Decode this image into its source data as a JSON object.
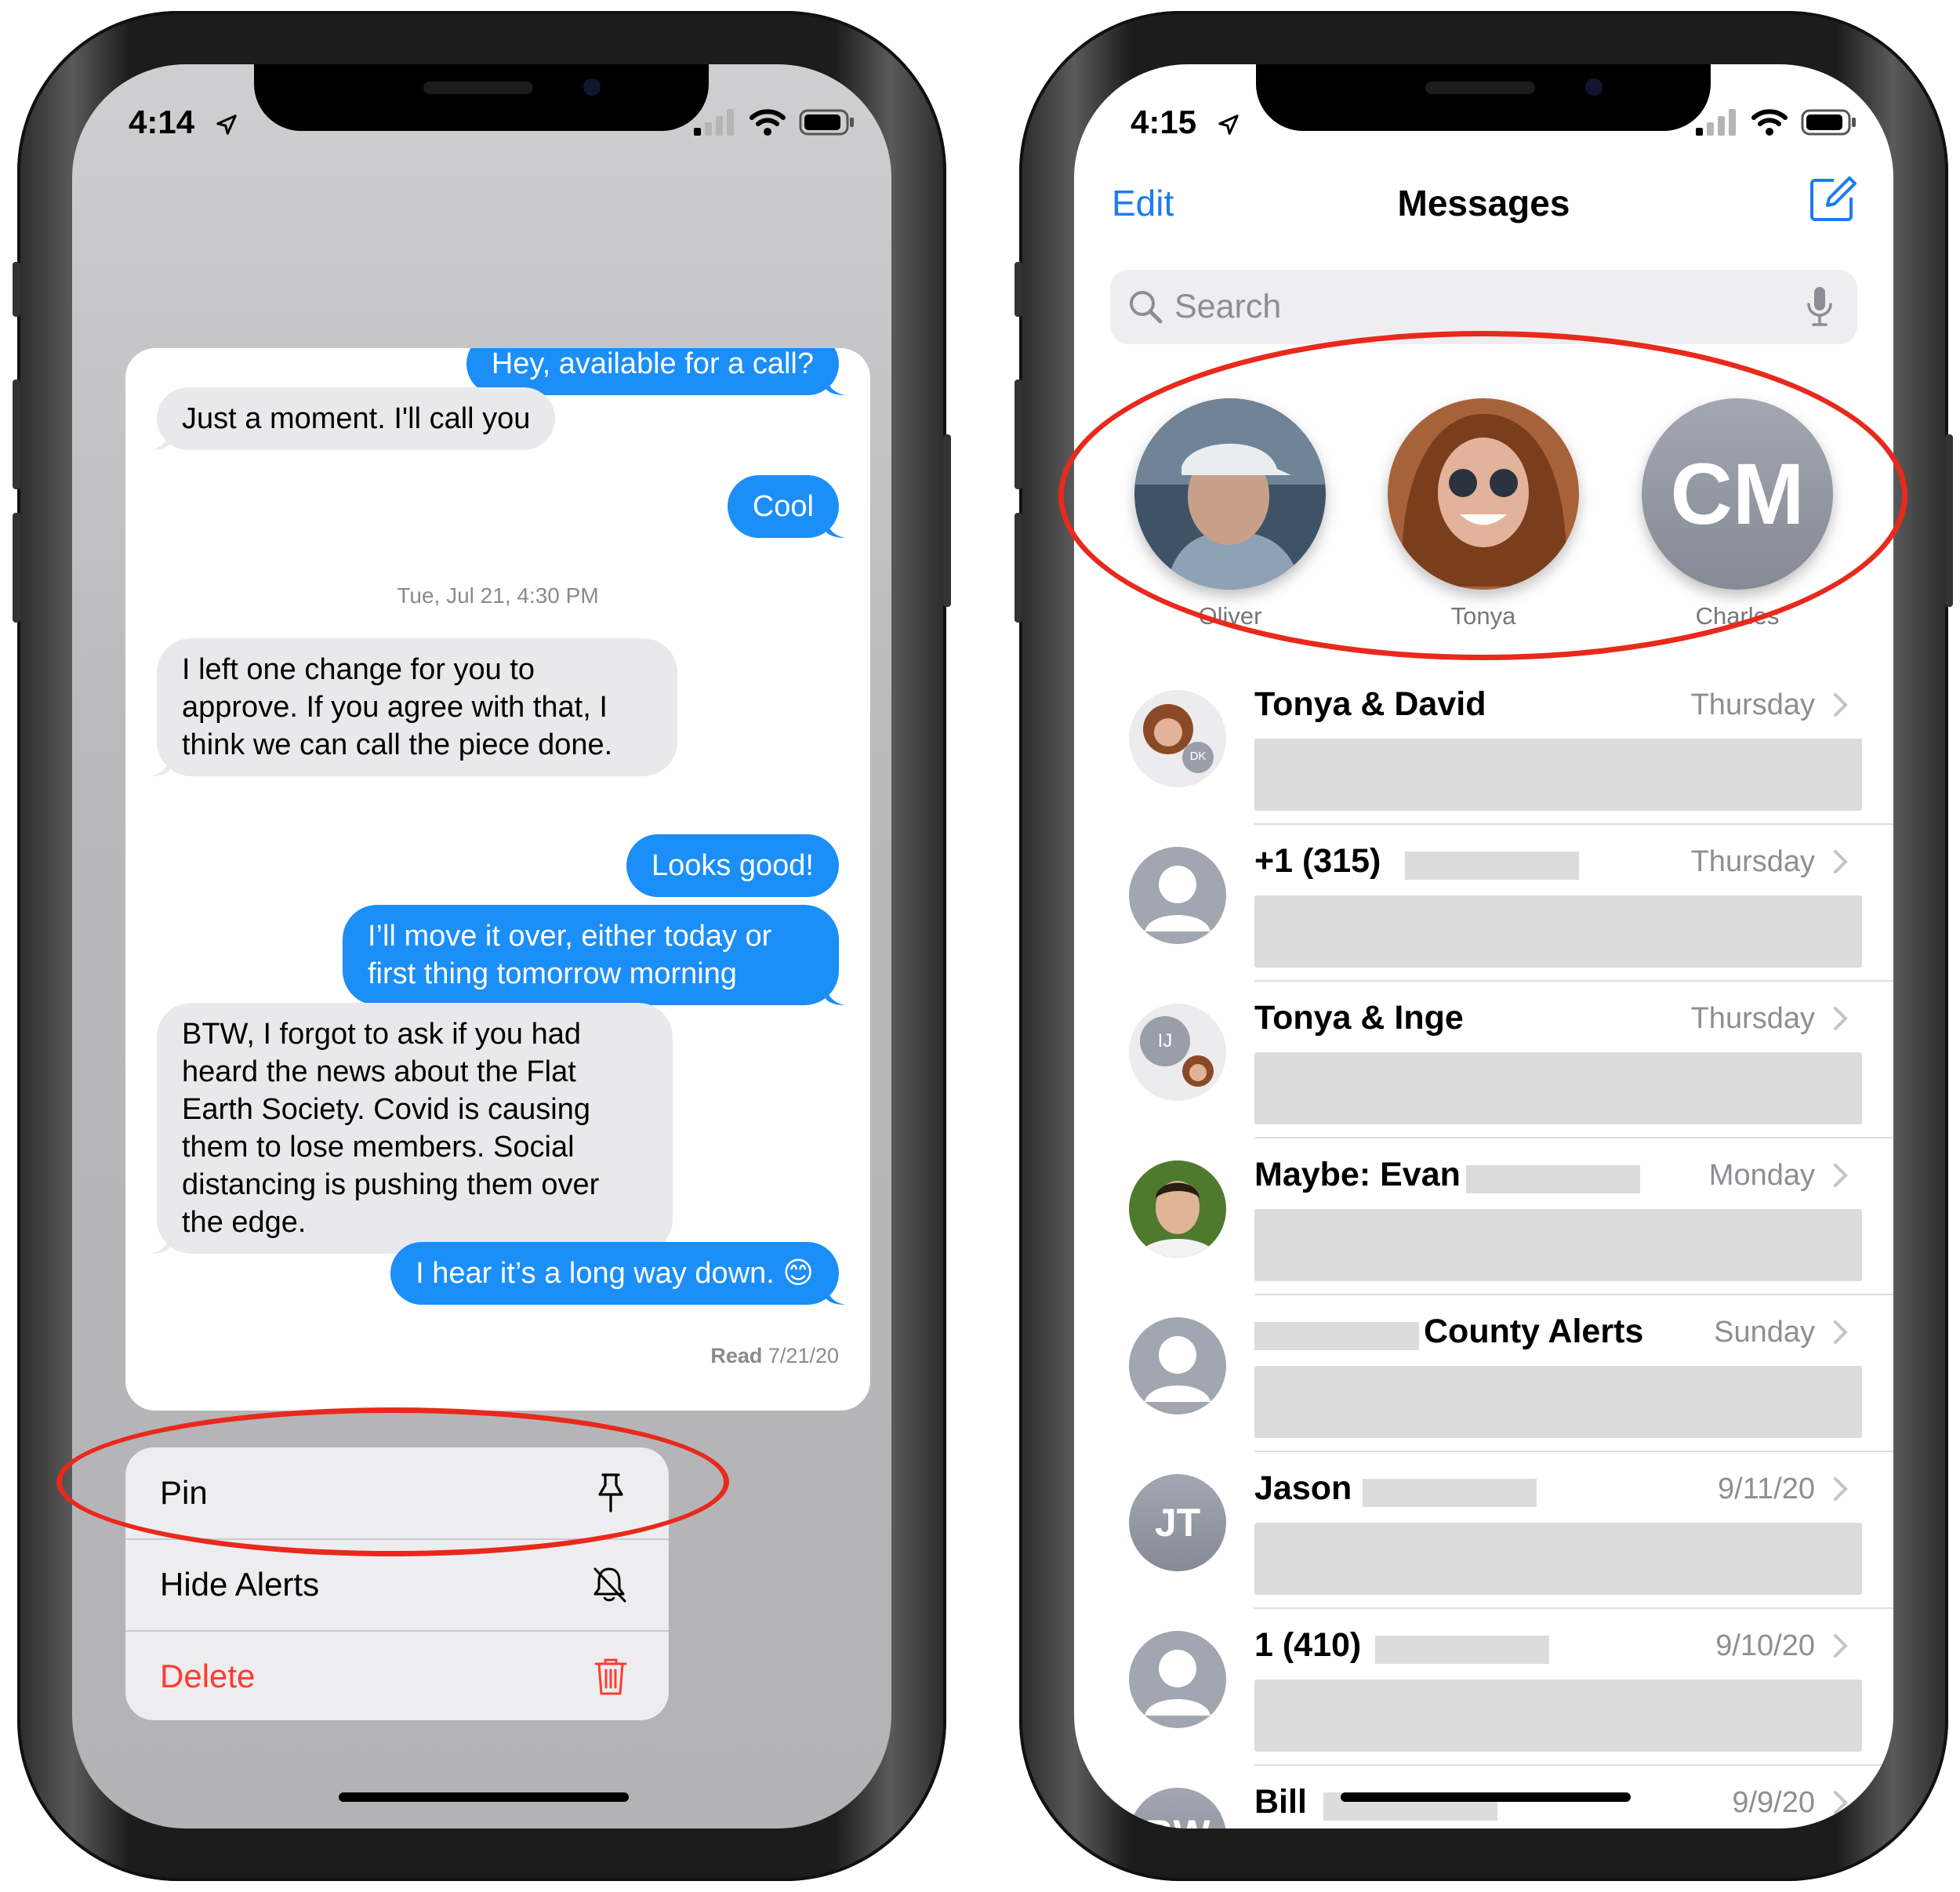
{
  "left_phone": {
    "status": {
      "time": "4:14"
    },
    "messages": [
      {
        "side": "out",
        "text": "Hey, available for a call?"
      },
      {
        "side": "in",
        "text": "Just a moment. I'll call you"
      },
      {
        "side": "out",
        "text": "Cool"
      },
      {
        "side": "in",
        "text": "I left one change for you to approve. If you agree with that, I think we can call the piece done."
      },
      {
        "side": "out",
        "text": "Looks good!"
      },
      {
        "side": "out",
        "text": "I’ll move it over, either today or first thing tomorrow morning"
      },
      {
        "side": "in",
        "text": "BTW, I forgot to ask if you had heard the news about the Flat Earth Society.  Covid is causing them to lose members. Social distancing is pushing them over the edge."
      },
      {
        "side": "out",
        "text": "I hear it’s a long way down. 😊"
      }
    ],
    "timestamp": "Tue, Jul 21, 4:30 PM",
    "read_receipt": {
      "label": "Read",
      "date": "7/21/20"
    },
    "context_menu": {
      "pin": "Pin",
      "hide_alerts": "Hide Alerts",
      "delete": "Delete"
    }
  },
  "right_phone": {
    "status": {
      "time": "4:15"
    },
    "nav": {
      "edit": "Edit",
      "title": "Messages"
    },
    "search": {
      "placeholder": "Search"
    },
    "pinned": [
      {
        "name": "Oliver"
      },
      {
        "name": "Tonya"
      },
      {
        "name": "Charles",
        "initials": "CM"
      }
    ],
    "conversations": [
      {
        "name": "Tonya & David",
        "date": "Thursday",
        "badge": "DK"
      },
      {
        "name": "+1 (315)",
        "date": "Thursday"
      },
      {
        "name": "Tonya & Inge",
        "date": "Thursday",
        "badge": "IJ"
      },
      {
        "name": "Maybe: Evan",
        "date": "Monday"
      },
      {
        "name": "County Alerts",
        "date": "Sunday"
      },
      {
        "name": "Jason",
        "date": "9/11/20",
        "initials": "JT"
      },
      {
        "name": "1 (410)",
        "date": "9/10/20"
      },
      {
        "name": "Bill",
        "date": "9/9/20",
        "initials": "BW"
      }
    ]
  },
  "colors": {
    "imessage_blue": "#1b8ef8",
    "ios_link_blue": "#1b7cf2",
    "destructive_red": "#ff3b30",
    "annotation_red": "#e8291c"
  }
}
